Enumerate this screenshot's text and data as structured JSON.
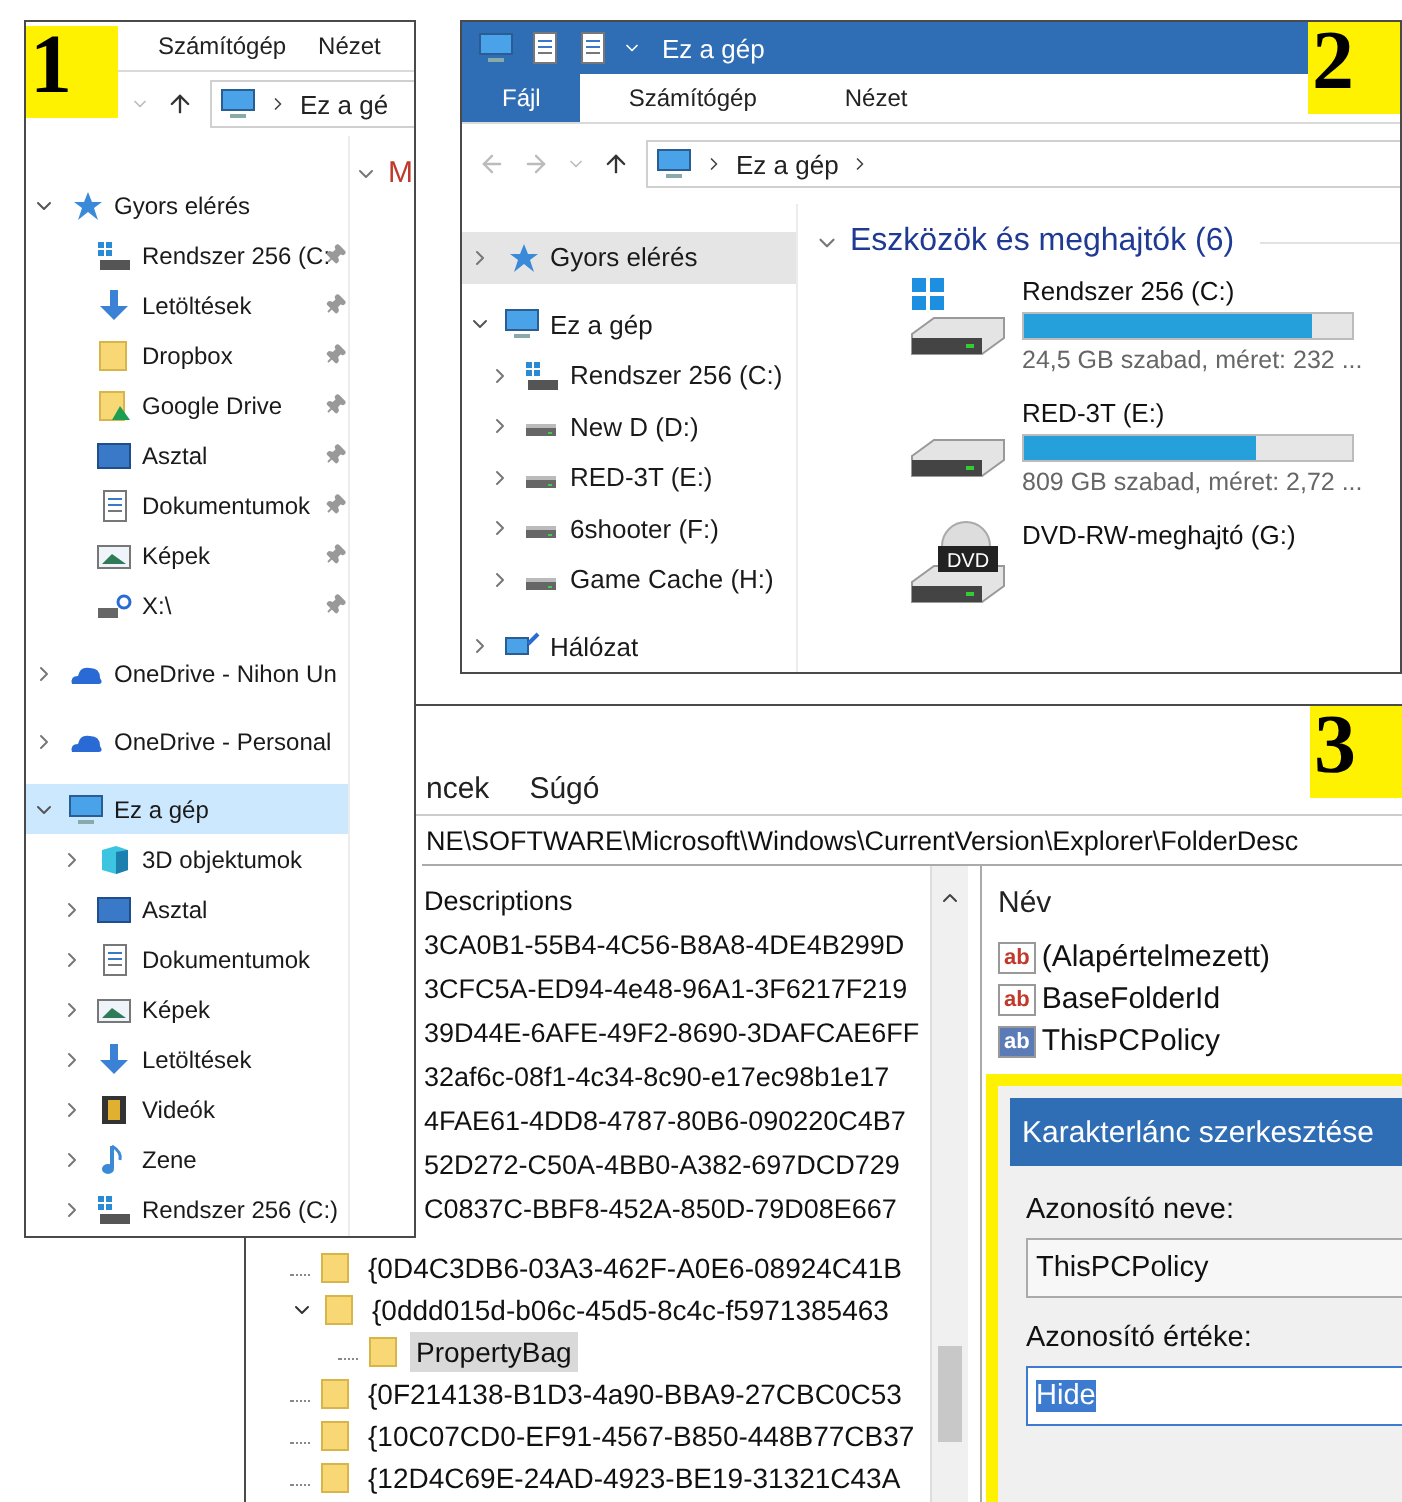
{
  "panel_1": {
    "badge": "1",
    "ribbon_tabs": [
      {
        "label": "Számítógép",
        "selected": false
      },
      {
        "label": "Nézet",
        "selected": false
      }
    ],
    "address": {
      "crumbs": [
        "Ez a gé"
      ]
    },
    "nav_tree": [
      {
        "label": "Gyors elérés",
        "kind": "star",
        "expanded": true,
        "selected": false,
        "children": [
          {
            "label": "Rendszer 256 (C:",
            "kind": "win-drive",
            "pinned": true,
            "selected": false
          },
          {
            "label": "Letöltések",
            "kind": "download",
            "pinned": true,
            "selected": false
          },
          {
            "label": "Dropbox",
            "kind": "folder",
            "pinned": true,
            "selected": false
          },
          {
            "label": "Google Drive",
            "kind": "gdrive",
            "pinned": true,
            "selected": false
          },
          {
            "label": "Asztal",
            "kind": "desktop",
            "pinned": true,
            "selected": false
          },
          {
            "label": "Dokumentumok",
            "kind": "document",
            "pinned": true,
            "selected": false
          },
          {
            "label": "Képek",
            "kind": "picture",
            "pinned": true,
            "selected": false
          },
          {
            "label": "X:\\",
            "kind": "netdrive",
            "pinned": true,
            "selected": false
          }
        ]
      },
      {
        "label": "OneDrive - Nihon Un",
        "kind": "cloud",
        "expanded": false,
        "selected": false
      },
      {
        "label": "OneDrive - Personal",
        "kind": "cloud",
        "expanded": false,
        "selected": false
      },
      {
        "label": "Ez a gép",
        "kind": "computer",
        "expanded": true,
        "selected": true,
        "children": [
          {
            "label": "3D objektumok",
            "kind": "cube",
            "expanded": false,
            "selected": false
          },
          {
            "label": "Asztal",
            "kind": "desktop",
            "expanded": false,
            "selected": false
          },
          {
            "label": "Dokumentumok",
            "kind": "document",
            "expanded": false,
            "selected": false
          },
          {
            "label": "Képek",
            "kind": "picture",
            "expanded": false,
            "selected": false
          },
          {
            "label": "Letöltések",
            "kind": "download",
            "expanded": false,
            "selected": false
          },
          {
            "label": "Videók",
            "kind": "video",
            "expanded": false,
            "selected": false
          },
          {
            "label": "Zene",
            "kind": "music",
            "expanded": false,
            "selected": false
          },
          {
            "label": "Rendszer 256 (C:)",
            "kind": "win-drive",
            "expanded": false,
            "selected": false
          }
        ]
      }
    ],
    "group_headers": [
      {
        "label": "M",
        "expanded": true
      }
    ]
  },
  "panel_2": {
    "badge": "2",
    "title": "Ez a gép",
    "ribbon_tabs": [
      {
        "label": "Fájl",
        "selected": true
      },
      {
        "label": "Számítógép",
        "selected": false
      },
      {
        "label": "Nézet",
        "selected": false
      }
    ],
    "address": {
      "crumbs": [
        "Ez a gép"
      ]
    },
    "nav_tree": [
      {
        "label": "Gyors elérés",
        "kind": "star",
        "expanded": false,
        "selected": false,
        "hovered": true
      },
      {
        "label": "Ez a gép",
        "kind": "computer",
        "expanded": true,
        "selected": false,
        "hovered": false,
        "children": [
          {
            "label": "Rendszer 256 (C:)",
            "kind": "win-drive",
            "expanded": false,
            "selected": false
          },
          {
            "label": "New D (D:)",
            "kind": "drive",
            "expanded": false,
            "selected": false
          },
          {
            "label": "RED-3T (E:)",
            "kind": "drive",
            "expanded": false,
            "selected": false
          },
          {
            "label": "6shooter (F:)",
            "kind": "drive",
            "expanded": false,
            "selected": false
          },
          {
            "label": "Game Cache (H:)",
            "kind": "drive",
            "expanded": false,
            "selected": false
          }
        ]
      },
      {
        "label": "Hálózat",
        "kind": "network",
        "expanded": false,
        "selected": false,
        "hovered": false
      }
    ],
    "group": {
      "title": "Eszközök és meghajtók (6)",
      "expanded": true
    },
    "drives": [
      {
        "name": "Rendszer 256 (C:)",
        "kind": "win-drive",
        "level": 0.88,
        "info": "24,5 GB szabad, méret: 232 ..."
      },
      {
        "name": "RED-3T (E:)",
        "kind": "drive",
        "level": 0.71,
        "info": "809 GB szabad, méret: 2,72 ..."
      },
      {
        "name": "DVD-RW-meghajtó (G:)",
        "kind": "dvd",
        "icon_text": "DVD"
      }
    ]
  },
  "panel_3": {
    "badge": "3",
    "menu": [
      "ncek",
      "Súgó"
    ],
    "address": "NE\\SOFTWARE\\Microsoft\\Windows\\CurrentVersion\\Explorer\\FolderDesc",
    "tree": [
      {
        "label": "Descriptions",
        "kind": "cut"
      },
      {
        "label": "3CA0B1-55B4-4C56-B8A8-4DE4B299D",
        "kind": "cut"
      },
      {
        "label": "3CFC5A-ED94-4e48-96A1-3F6217F219",
        "kind": "cut"
      },
      {
        "label": "39D44E-6AFE-49F2-8690-3DAFCAE6FF",
        "kind": "cut"
      },
      {
        "label": "32af6c-08f1-4c34-8c90-e17ec98b1e17",
        "kind": "cut"
      },
      {
        "label": "4FAE61-4DD8-4787-80B6-090220C4B7",
        "kind": "cut"
      },
      {
        "label": "52D272-C50A-4BB0-A382-697DCD729",
        "kind": "cut"
      },
      {
        "label": "C0837C-BBF8-452A-850D-79D08E667",
        "kind": "cut"
      },
      {
        "label": "{0D4C3DB6-03A3-462F-A0E6-08924C41B",
        "kind": "folder",
        "selected": false
      },
      {
        "label": "{0ddd015d-b06c-45d5-8c4c-f5971385463",
        "kind": "folder",
        "selected": false,
        "expanded": true,
        "children": [
          {
            "label": "PropertyBag",
            "kind": "folder",
            "selected": true
          }
        ]
      },
      {
        "label": "{0F214138-B1D3-4a90-BBA9-27CBC0C53",
        "kind": "folder",
        "selected": false
      },
      {
        "label": "{10C07CD0-EF91-4567-B850-448B77CB37",
        "kind": "folder",
        "selected": false
      },
      {
        "label": "{12D4C69E-24AD-4923-BE19-31321C43A",
        "kind": "folder",
        "selected": false
      }
    ],
    "values": {
      "column": "Név",
      "rows": [
        {
          "name": "(Alapértelmezett)",
          "icon_text": "ab",
          "selected": false
        },
        {
          "name": "BaseFolderId",
          "icon_text": "ab",
          "selected": false
        },
        {
          "name": "ThisPCPolicy",
          "icon_text": "ab",
          "selected": true
        }
      ]
    },
    "dialog": {
      "title": "Karakterlánc szerkesztése",
      "name_label": "Azonosító neve:",
      "name_value": "ThisPCPolicy",
      "value_label": "Azonosító értéke:",
      "value": "Hide",
      "value_selected": true
    }
  }
}
